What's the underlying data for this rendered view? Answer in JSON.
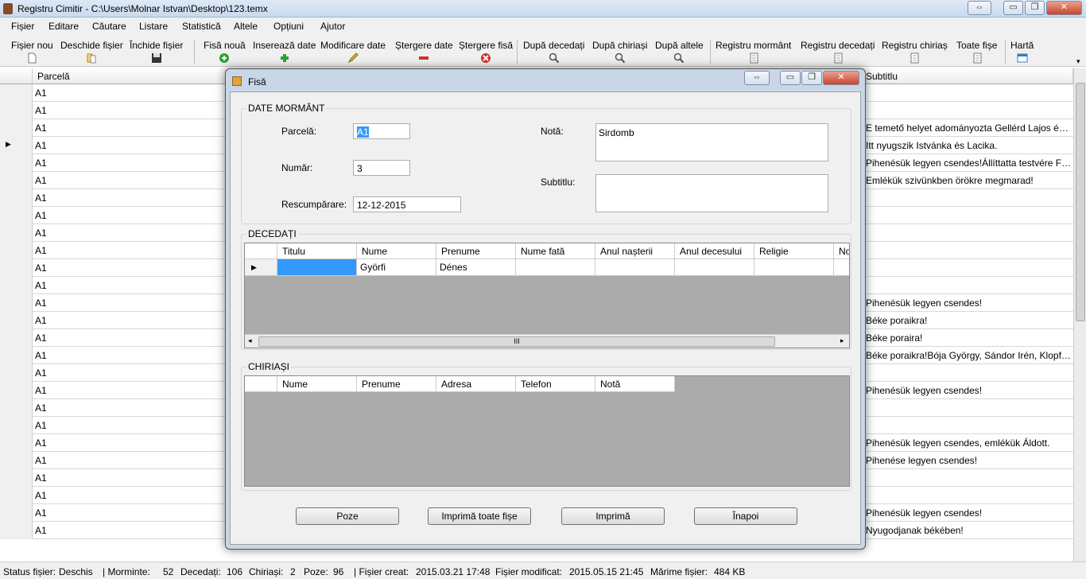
{
  "window": {
    "title": "Registru Cimitir  -  C:\\Users\\Molnar Istvan\\Desktop\\123.temx",
    "restore_glyph": "⇔",
    "min_glyph": "▭",
    "max_glyph": "❐",
    "close_glyph": "✕"
  },
  "menu": [
    "Fișier",
    "Editare",
    "Căutare",
    "Listare",
    "Statistică",
    "Altele",
    "Opțiuni",
    "Ajutor"
  ],
  "toolbar": [
    "Fișier nou",
    "Deschide fișier",
    "Închide fișier",
    "Fisă nouă",
    "Inserează date",
    "Modificare date",
    "Ștergere date",
    "Ștergere fisă",
    "După decedați",
    "După chiriași",
    "După altele",
    "Registru mormânt",
    "Registru decedați",
    "Registru chiriaș",
    "Toate fișe",
    "Hartă"
  ],
  "grid": {
    "col_parcela": "Parcelă",
    "col_subtitlu": "Subtitlu",
    "rows": [
      {
        "parcela": "A1",
        "subtitlu": ""
      },
      {
        "parcela": "A1",
        "subtitlu": ""
      },
      {
        "parcela": "A1",
        "subtitlu": "E temető helyet adományozta Gellérd Lajos és neje ..."
      },
      {
        "parcela": "A1",
        "subtitlu": "Itt nyugszik Istvánka és Lacika."
      },
      {
        "parcela": "A1",
        "subtitlu": "Pihenésük legyen csendes!Állíttatta testvére Ferenc."
      },
      {
        "parcela": "A1",
        "subtitlu": "Emlékük szivünkben örökre megmarad!"
      },
      {
        "parcela": "A1",
        "subtitlu": ""
      },
      {
        "parcela": "A1",
        "subtitlu": ""
      },
      {
        "parcela": "A1",
        "subtitlu": ""
      },
      {
        "parcela": "A1",
        "subtitlu": ""
      },
      {
        "parcela": "A1",
        "subtitlu": ""
      },
      {
        "parcela": "A1",
        "subtitlu": ""
      },
      {
        "parcela": "A1",
        "subtitlu": "Pihenésük legyen csendes!"
      },
      {
        "parcela": "A1",
        "subtitlu": "Béke poraikra!"
      },
      {
        "parcela": "A1",
        "subtitlu": "Béke poraira!"
      },
      {
        "parcela": "A1",
        "subtitlu": "Béke poraikra!Bója György, Sándor Irén, Klopfer Sá..."
      },
      {
        "parcela": "A1",
        "subtitlu": ""
      },
      {
        "parcela": "A1",
        "subtitlu": "Pihenésük legyen csendes!"
      },
      {
        "parcela": "A1",
        "subtitlu": ""
      },
      {
        "parcela": "A1",
        "subtitlu": ""
      },
      {
        "parcela": "A1",
        "subtitlu": "Pihenésük legyen csendes, emlékük Áldott."
      },
      {
        "parcela": "A1",
        "subtitlu": "Pihenése legyen csendes!"
      },
      {
        "parcela": "A1",
        "subtitlu": ""
      },
      {
        "parcela": "A1",
        "subtitlu": ""
      },
      {
        "parcela": "A1",
        "subtitlu": "Pihenésük legyen csendes!"
      },
      {
        "parcela": "A1",
        "subtitlu": "Nyugodjanak békében!"
      }
    ]
  },
  "status": {
    "status_label": "Status fișier:",
    "status_value": "Deschis",
    "morminte_label": "| Morminte:",
    "morminte_value": "52",
    "decedati_label": "Decedați:",
    "decedati_value": "106",
    "chiriasi_label": "Chiriași:",
    "chiriasi_value": "2",
    "poze_label": "Poze:",
    "poze_value": "96",
    "creat_label": "| Fișier creat:",
    "creat_value": "2015.03.21 17:48",
    "modificat_label": "Fișier modificat:",
    "modificat_value": "2015.05.15 21:45",
    "marime_label": "Mărime fișier:",
    "marime_value": "484 KB"
  },
  "dialog": {
    "title": "Fisă",
    "group_mormant": "DATE MORMÂNT",
    "parcela_label": "Parcelă:",
    "parcela_value": "A1",
    "numar_label": "Număr:",
    "numar_value": "3",
    "rescumparare_label": "Rescumpărare:",
    "rescumparare_value": "12-12-2015",
    "nota_label": "Notă:",
    "nota_value": "Sirdomb",
    "subtitlu_label": "Subtitlu:",
    "subtitlu_value": "",
    "group_decedati": "DECEDAȚI",
    "decedati_cols": [
      "Titulu",
      "Nume",
      "Prenume",
      "Nume fată",
      "Anul nașterii",
      "Anul decesului",
      "Religie",
      "No"
    ],
    "decedati_row": {
      "titulu": "",
      "nume": "Györfi",
      "prenume": "Dénes"
    },
    "scroll_grip": "III",
    "group_chiriasi": "CHIRIAȘI",
    "chiriasi_cols": [
      "Nume",
      "Prenume",
      "Adresa",
      "Telefon",
      "Notă"
    ],
    "buttons": {
      "poze": "Poze",
      "imprima_toate": "Imprimă toate fișe",
      "imprima": "Imprimă",
      "inapoi": "Înapoi"
    }
  }
}
